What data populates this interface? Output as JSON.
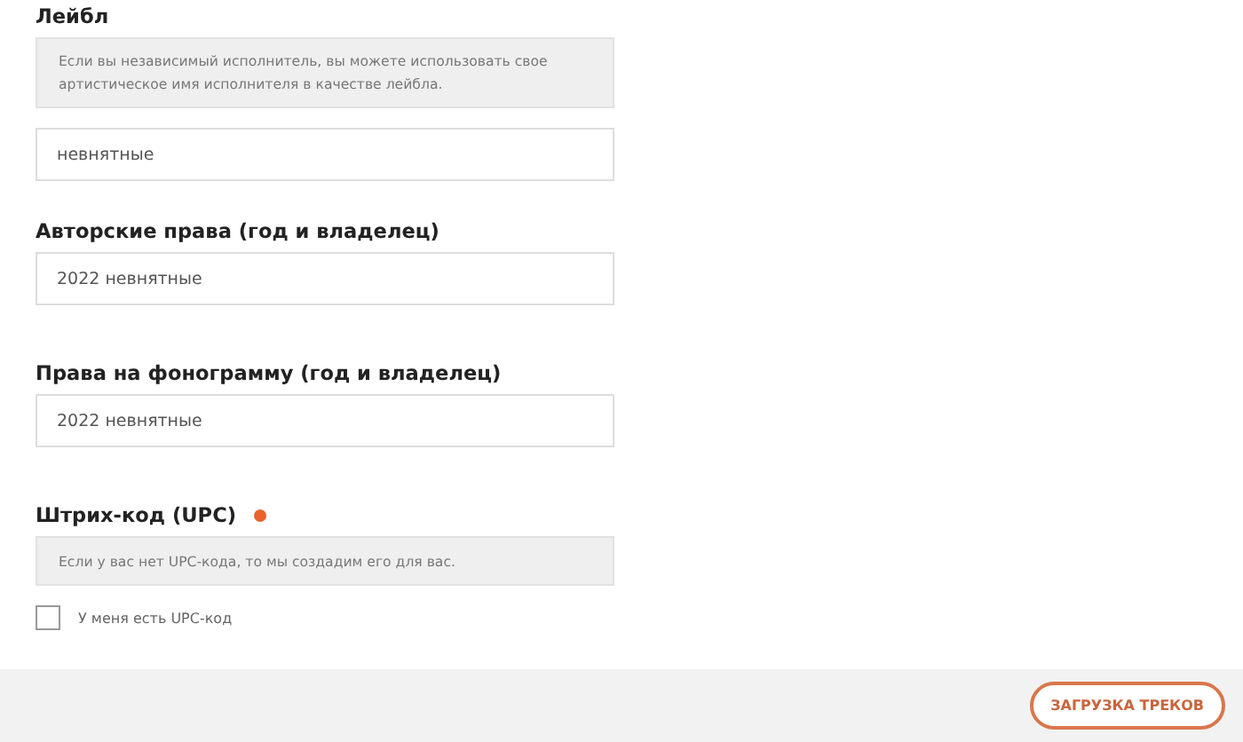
{
  "sections": [
    {
      "title": "Лейбл",
      "help": false,
      "note": "Если вы независимый исполнитель, вы можете использовать свое артистическое имя исполнителя в качестве лейбла.",
      "value": "невнятные"
    },
    {
      "title": "Авторские права (год и владелец)",
      "help": false,
      "value": "2022 невнятные"
    },
    {
      "title": "Права на фонограмму (год и владелец)",
      "help": false,
      "value": "2022 невнятные"
    },
    {
      "title": "Штрих-код (UPC)",
      "help": true,
      "note": "Если у вас нет UPC-кода, то мы создадим его для вас.",
      "checkbox": {
        "label": "У меня есть UPC-код",
        "checked": false
      }
    }
  ],
  "footer": {
    "button": "ЗАГРУЗКА ТРЕКОВ"
  }
}
